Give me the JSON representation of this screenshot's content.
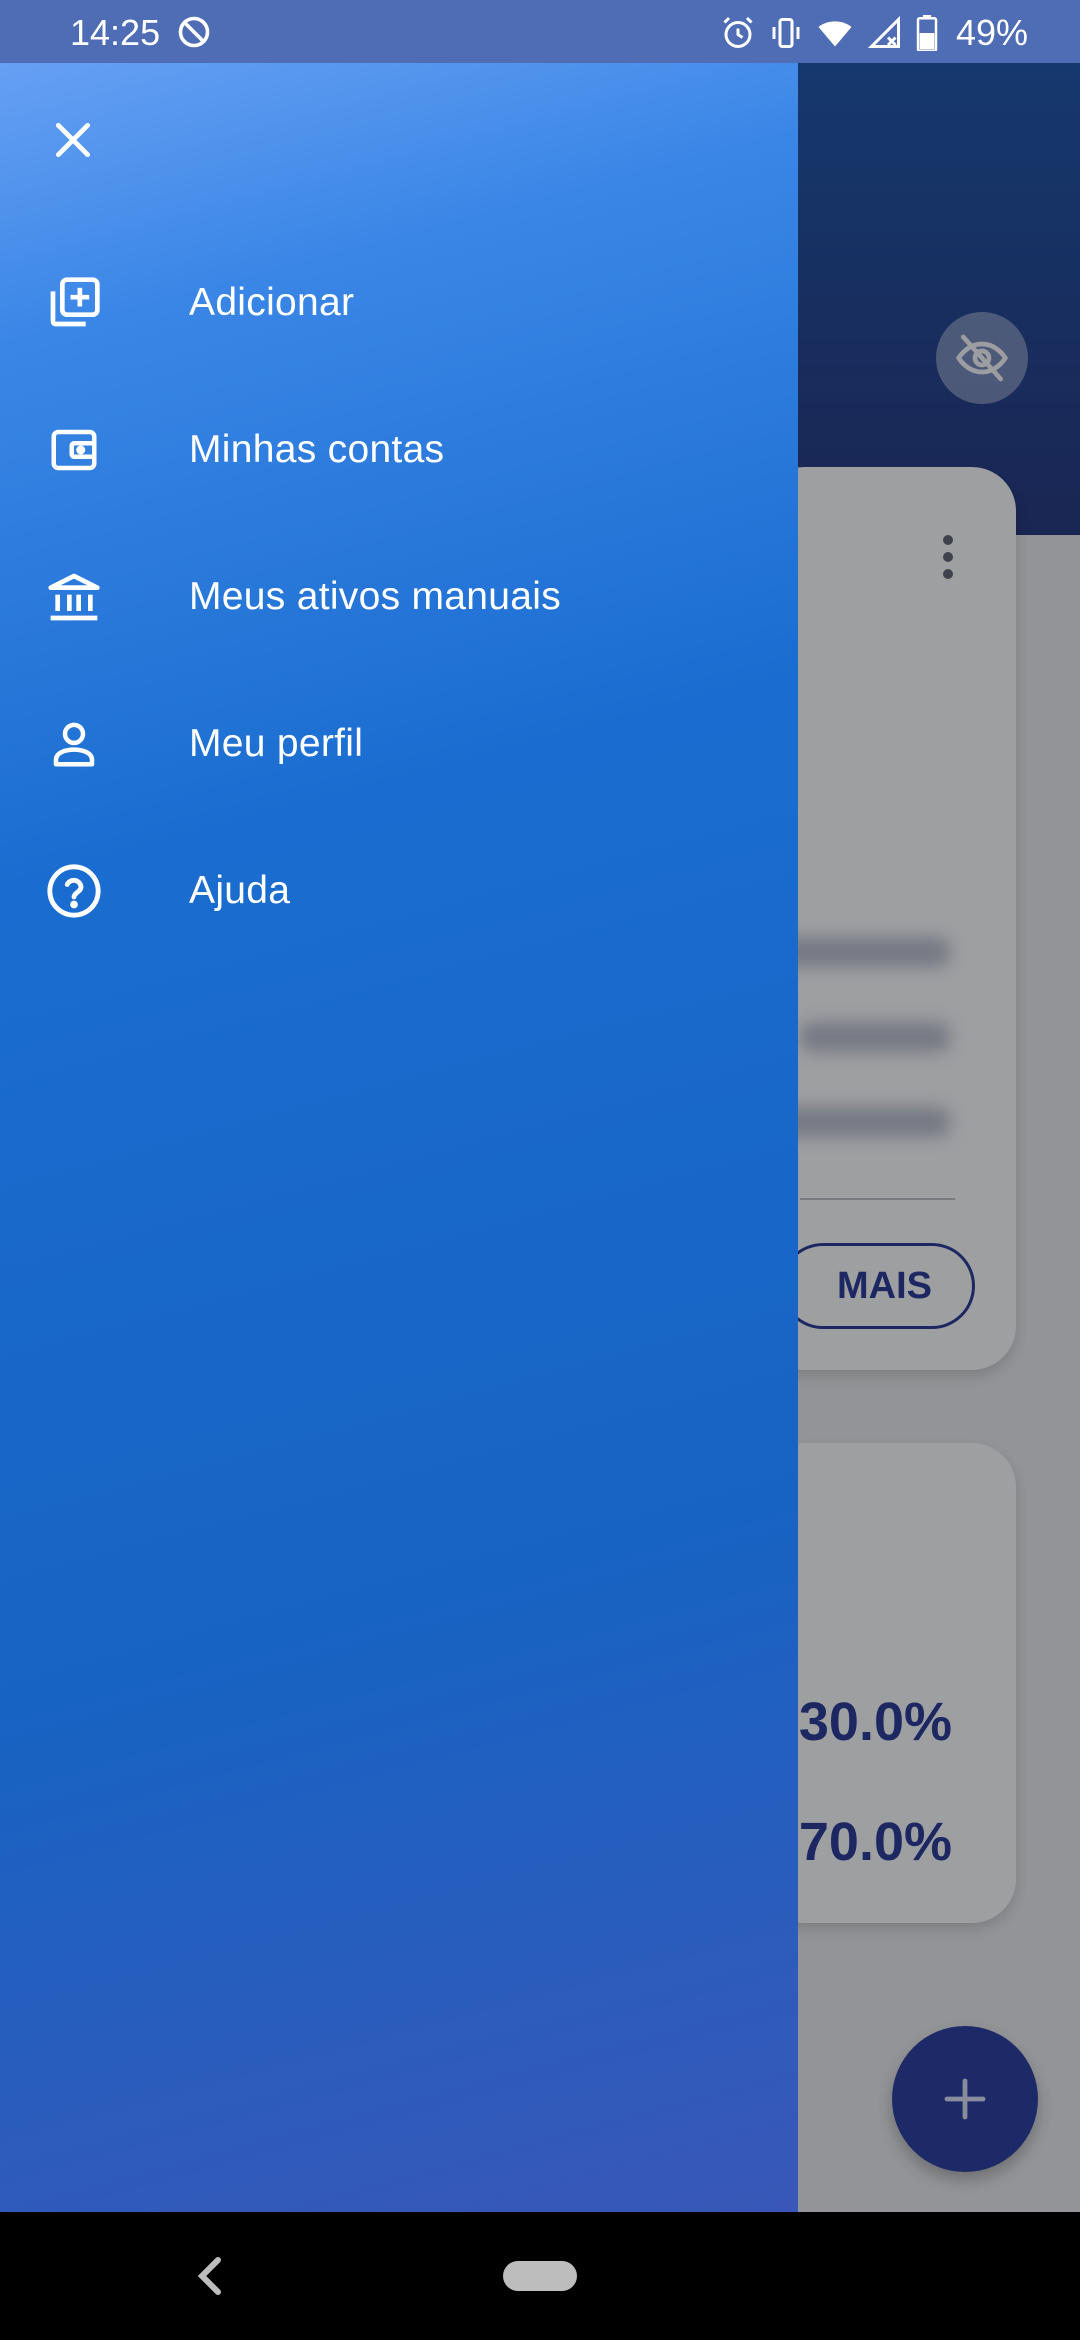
{
  "status_bar": {
    "time": "14:25",
    "battery": "49%",
    "icons": [
      "do-not-disturb-icon",
      "alarm-icon",
      "vibrate-icon",
      "wifi-icon",
      "no-signal-icon",
      "battery-icon"
    ]
  },
  "drawer": {
    "close_icon": "close-icon",
    "items": [
      {
        "label": "Adicionar",
        "icon": "add-box-icon"
      },
      {
        "label": "Minhas contas",
        "icon": "wallet-icon"
      },
      {
        "label": "Meus ativos manuais",
        "icon": "bank-icon"
      },
      {
        "label": "Meu perfil",
        "icon": "person-icon"
      },
      {
        "label": "Ajuda",
        "icon": "help-circle-icon"
      }
    ]
  },
  "background": {
    "more_button_label": "MAIS",
    "percent_1": "30.0%",
    "percent_2": "70.0%"
  },
  "colors": {
    "drawer_top": "#66a0f4",
    "drawer_mid": "#1763c3",
    "drawer_bottom": "#3957b8",
    "accent_dark": "#2b3a8f"
  }
}
